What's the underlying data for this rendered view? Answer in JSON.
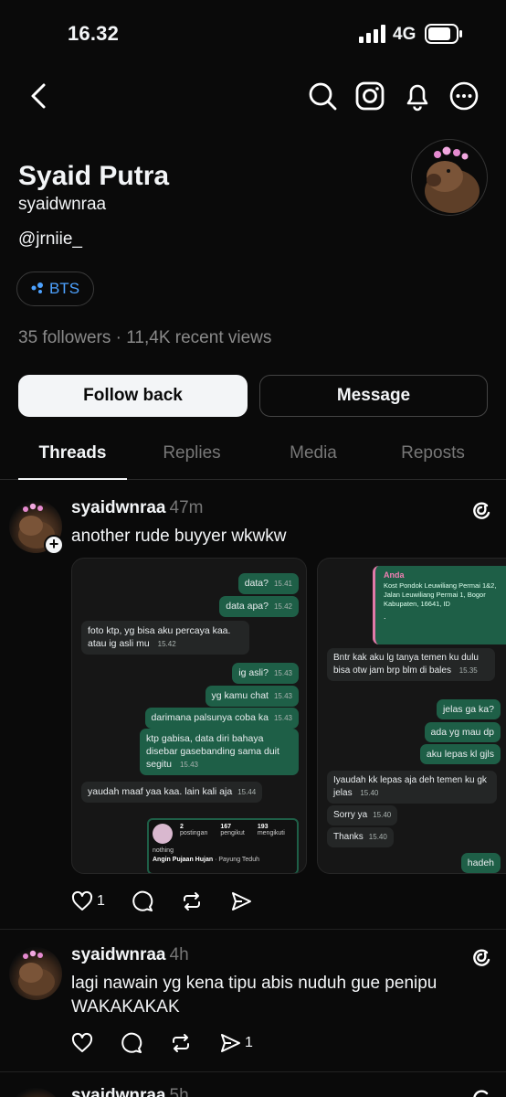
{
  "status_bar": {
    "time": "16.32",
    "network": "4G"
  },
  "header_icons": [
    "back-icon",
    "search-icon",
    "instagram-icon",
    "bell-icon",
    "more-icon"
  ],
  "profile": {
    "name": "Syaid Putra",
    "username": "syaidwnraa",
    "bio": "@jrniie_",
    "tag": "BTS",
    "stats": "35 followers · 11,4K recent views"
  },
  "buttons": {
    "follow": "Follow back",
    "message": "Message"
  },
  "tabs": [
    "Threads",
    "Replies",
    "Media",
    "Reposts"
  ],
  "posts": [
    {
      "user": "syaidwnraa",
      "time": "47m",
      "text": "another rude buyyer wkwkw",
      "likes": "1",
      "shot1": {
        "messages": [
          {
            "text": "data?",
            "time": "15.41"
          },
          {
            "text": "data apa?",
            "time": "15.42"
          },
          {
            "text": "foto ktp, yg bisa aku percaya kaa. atau ig asli mu",
            "time": "15.42"
          },
          {
            "text": "ig asli?",
            "time": "15.43"
          },
          {
            "text": "yg kamu chat",
            "time": "15.43"
          },
          {
            "text": "darimana palsunya coba ka",
            "time": "15.43"
          },
          {
            "text": "ktp gabisa, data diri bahaya disebar gasebanding sama duit segitu",
            "time": "15.43"
          },
          {
            "text": "yaudah maaf yaa kaa. lain kali aja",
            "time": "15.44"
          }
        ],
        "profile_card": {
          "posts": "2",
          "posts_label": "postingan",
          "followers": "167",
          "followers_label": "pengikut",
          "following": "193",
          "following_label": "mengikuti",
          "name": "nothing",
          "song": "Angin Pujaan Hujan",
          "artist": "· Payung Teduh"
        }
      },
      "shot2": {
        "reply_name": "Anda",
        "reply_text": "Kost Pondok Leuwiliang Permai 1&2, Jalan Leuwiliang Permai 1, Bogor Kabupaten, 16641, ID",
        "messages": [
          {
            "text": "Bntr kak aku lg tanya temen ku dulu bisa otw jam brp blm di bales",
            "time": "15.35"
          },
          {
            "text": "jelas ga ka?",
            "time": ""
          },
          {
            "text": "ada yg mau dp",
            "time": ""
          },
          {
            "text": "aku lepas kl gjls",
            "time": ""
          },
          {
            "text": "Iyaudah kk lepas aja deh temen ku gk jelas",
            "time": "15.40"
          },
          {
            "text": "Sorry ya",
            "time": "15.40"
          },
          {
            "text": "Thanks",
            "time": "15.40"
          },
          {
            "text": "hadeh",
            "time": ""
          }
        ]
      }
    },
    {
      "user": "syaidwnraa",
      "time": "4h",
      "text": "lagi nawain yg kena tipu abis nuduh gue penipu WAKAKAKAK",
      "reposts": "1"
    },
    {
      "user": "syaidwnraa",
      "time": "5h"
    }
  ]
}
